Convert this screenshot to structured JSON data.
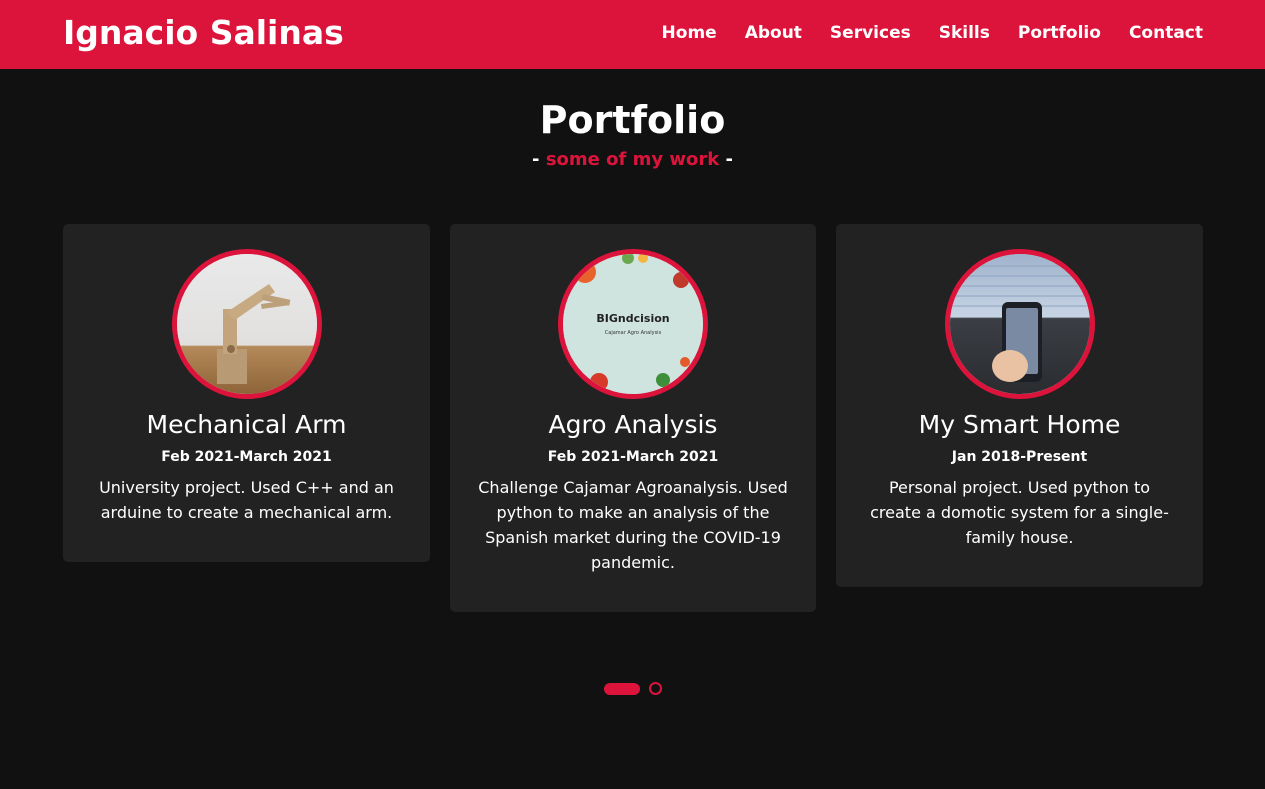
{
  "header": {
    "logo": "Ignacio Salinas",
    "nav": [
      "Home",
      "About",
      "Services",
      "Skills",
      "Portfolio",
      "Contact"
    ]
  },
  "section": {
    "title": "Portfolio",
    "subtitle_dash_left": "-",
    "subtitle": "some of my work",
    "subtitle_dash_right": "-"
  },
  "projects": [
    {
      "title": "Mechanical Arm",
      "date": "Feb 2021-March 2021",
      "description": "University project. Used C++ and an arduine to create a mechanical arm."
    },
    {
      "title": "Agro Analysis",
      "date": "Feb 2021-March 2021",
      "description": "Challenge Cajamar Agroanalysis. Used python to make an analysis of the Spanish market during the COVID-19 pandemic.",
      "thumb_text": "BIGndcision",
      "thumb_subtext": "Cajamar Agro Analysis"
    },
    {
      "title": "My Smart Home",
      "date": "Jan 2018-Present",
      "description": "Personal project. Used python to create a domotic system for a single-family house."
    }
  ],
  "carousel": {
    "pages": 2,
    "active": 1
  },
  "colors": {
    "accent": "#dc143c",
    "background": "#111111",
    "card": "#222222"
  }
}
